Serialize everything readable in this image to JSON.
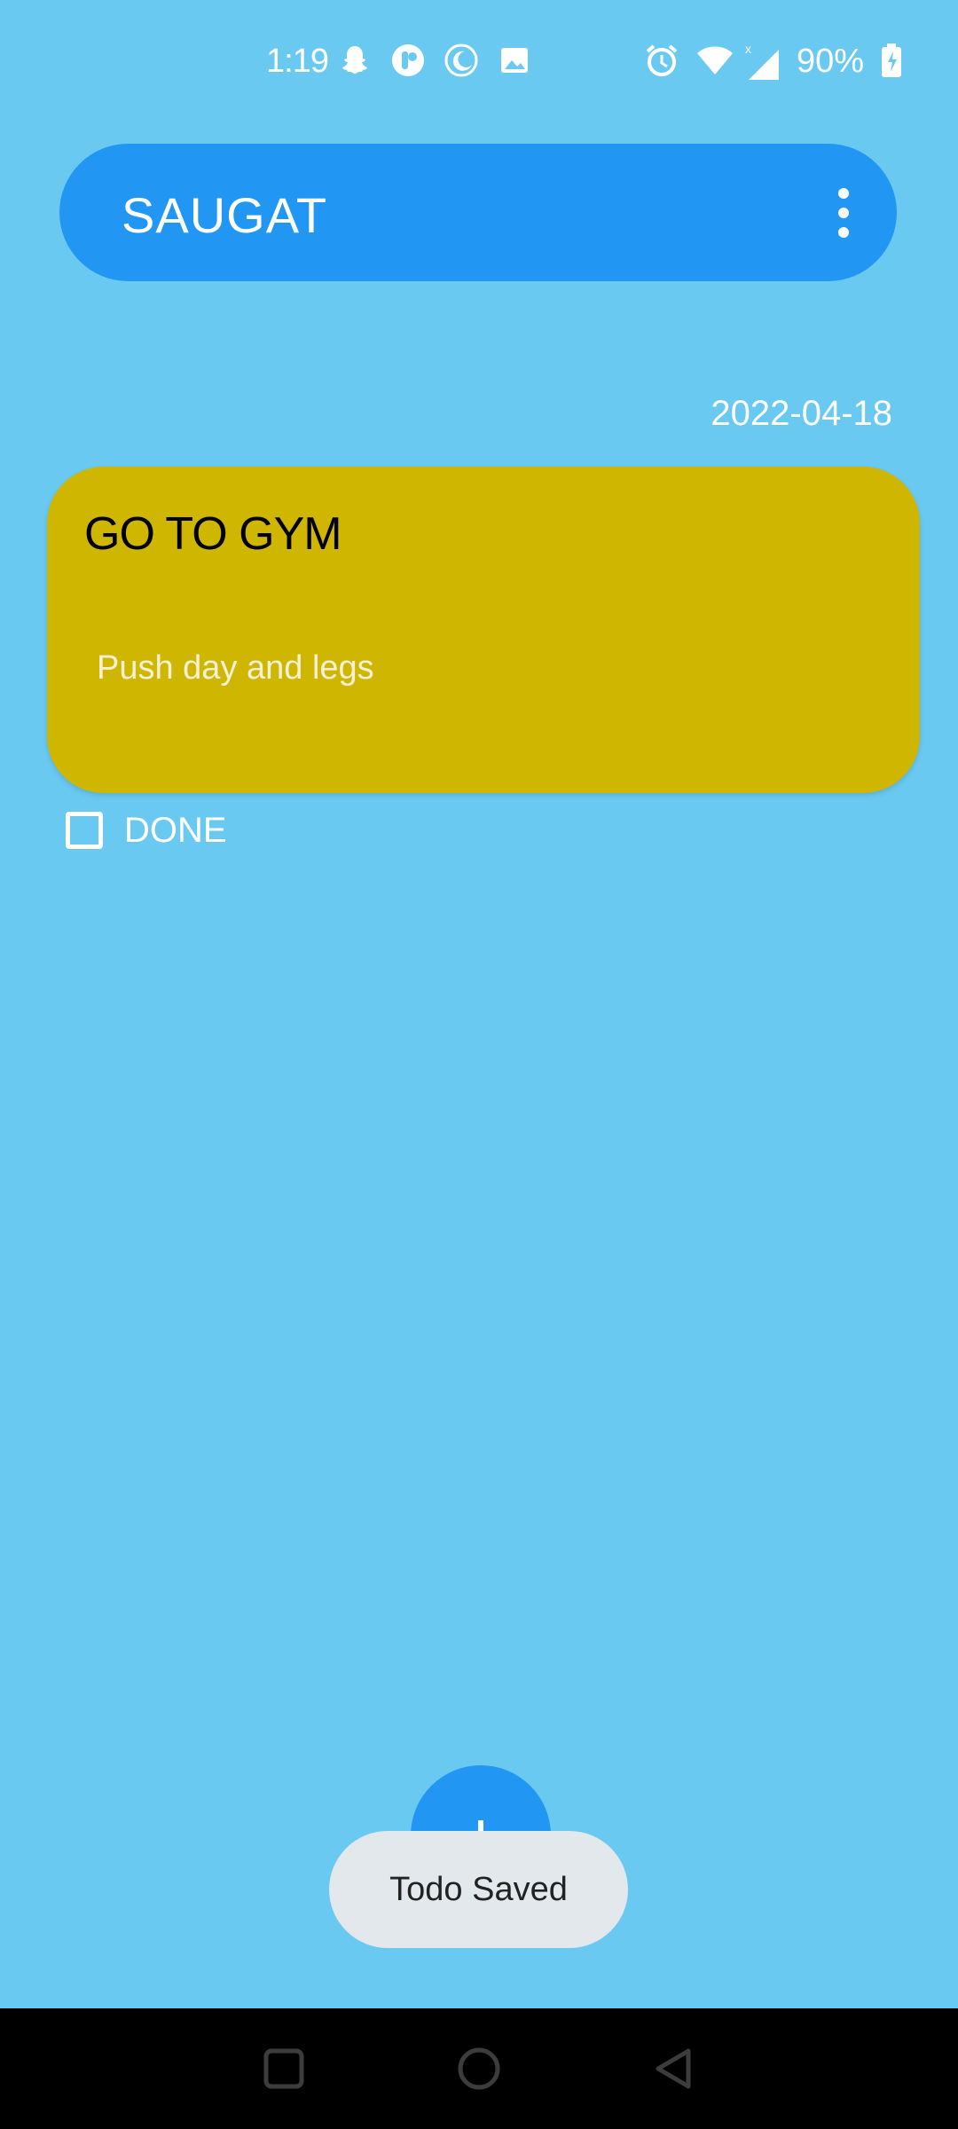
{
  "status_bar": {
    "time": "1:19",
    "battery": "90%",
    "icons": [
      "snapchat-icon",
      "app-icon",
      "moon-icon",
      "image-icon",
      "alarm-icon",
      "wifi-icon",
      "signal-icon",
      "battery-icon"
    ]
  },
  "app_bar": {
    "title": "SAUGAT",
    "menu_icon": "more-vert-icon"
  },
  "main": {
    "date": "2022-04-18",
    "todo": {
      "title": "GO TO GYM",
      "description": "Push day and legs",
      "color": "#cfb600"
    },
    "done_checkbox": {
      "label": "DONE",
      "checked": false
    }
  },
  "fab": {
    "icon": "plus-icon"
  },
  "toast": {
    "text": "Todo Saved"
  },
  "nav_bar": {
    "buttons": [
      "recents-icon",
      "home-icon",
      "back-icon"
    ]
  },
  "colors": {
    "background": "#6ac9f1",
    "primary": "#2196f3",
    "card": "#cfb600"
  }
}
